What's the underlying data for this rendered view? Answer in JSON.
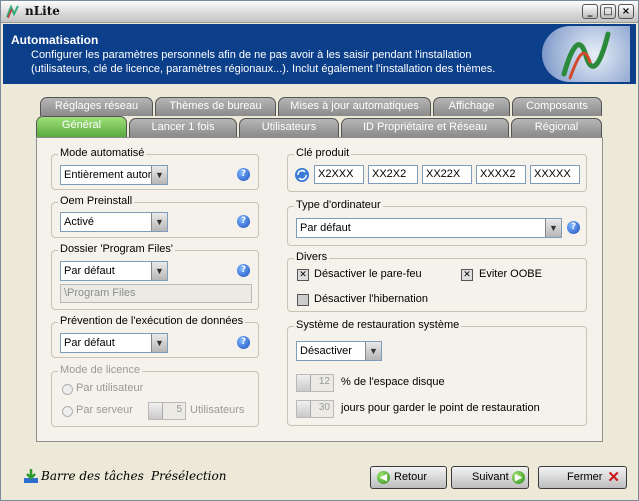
{
  "window": {
    "title": "nLite"
  },
  "header": {
    "title": "Automatisation",
    "description": "Configurer les paramètres personnels afin de ne pas avoir à les saisir pendant l'installation (utilisateurs, clé de licence, paramètres régionaux...). Inclut également l'installation des thèmes."
  },
  "tabs": {
    "row1": [
      "Réglages réseau",
      "Thèmes de bureau",
      "Mises à jour automatiques",
      "Affichage",
      "Composants"
    ],
    "row2": [
      "Général",
      "Lancer 1 fois",
      "Utilisateurs",
      "ID Propriétaire et Réseau",
      "Régional"
    ],
    "active": "Général"
  },
  "mode_automatise": {
    "label": "Mode automatisé",
    "value": "Entièrement autor"
  },
  "oem_preinstall": {
    "label": "Oem Preinstall",
    "value": "Activé"
  },
  "program_files": {
    "label": "Dossier 'Program Files'",
    "value": "Par défaut",
    "path": "\\Program Files"
  },
  "dep": {
    "label": "Prévention de l'exécution de données",
    "value": "Par défaut"
  },
  "licence": {
    "label": "Mode de licence",
    "per_user": "Par utilisateur",
    "per_server": "Par serveur",
    "users_count": "5",
    "users_label": "Utilisateurs"
  },
  "product_key": {
    "label": "Clé produit",
    "parts": [
      "X2XXX",
      "XX2X2",
      "XX22X",
      "XXXX2",
      "XXXXX"
    ]
  },
  "computer_type": {
    "label": "Type d'ordinateur",
    "value": "Par défaut"
  },
  "divers": {
    "label": "Divers",
    "firewall": "Désactiver le pare-feu",
    "oobe": "Eviter OOBE",
    "hibernation": "Désactiver l'hibernation"
  },
  "restore": {
    "label": "Système de restauration système",
    "value": "Désactiver",
    "disk_percent": "12",
    "disk_label": "% de l'espace disque",
    "days": "30",
    "days_label": "jours pour garder le point de restauration"
  },
  "footer": {
    "taskbar": "Barre des tâches",
    "preselection": "Présélection",
    "back": "Retour",
    "next": "Suivant",
    "close": "Fermer"
  }
}
